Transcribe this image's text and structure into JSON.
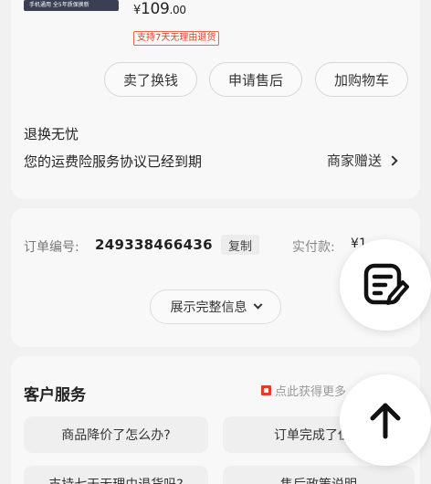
{
  "product": {
    "banner_text": "手机通用 全5年质保换新",
    "price_currency": "¥",
    "price_int": "109",
    "price_dec": ".00",
    "return_tag": "支持7天无理由退货"
  },
  "actions": {
    "sell": "卖了换钱",
    "after_sale": "申请售后",
    "add_cart": "加购物车"
  },
  "service": {
    "return_worry": "退换无忧",
    "insurance_msg": "您的运费险服务协议已经到期",
    "merchant_gift": "商家赠送"
  },
  "order": {
    "number_label": "订单编号:",
    "number_value": "249338466436",
    "copy_label": "复制",
    "paid_label": "实付款:",
    "paid_value": "¥1",
    "expand_label": "展示完整信息"
  },
  "customer_service": {
    "title": "客户服务",
    "more_link": "点此获得更多",
    "questions": [
      "商品降价了怎么办?",
      "订单完成了但没",
      "支持七天无理由退货吗?",
      "售后政策说明"
    ]
  },
  "icons": {
    "edit_fab": "note-edit-icon",
    "top_fab": "arrow-up-icon"
  }
}
